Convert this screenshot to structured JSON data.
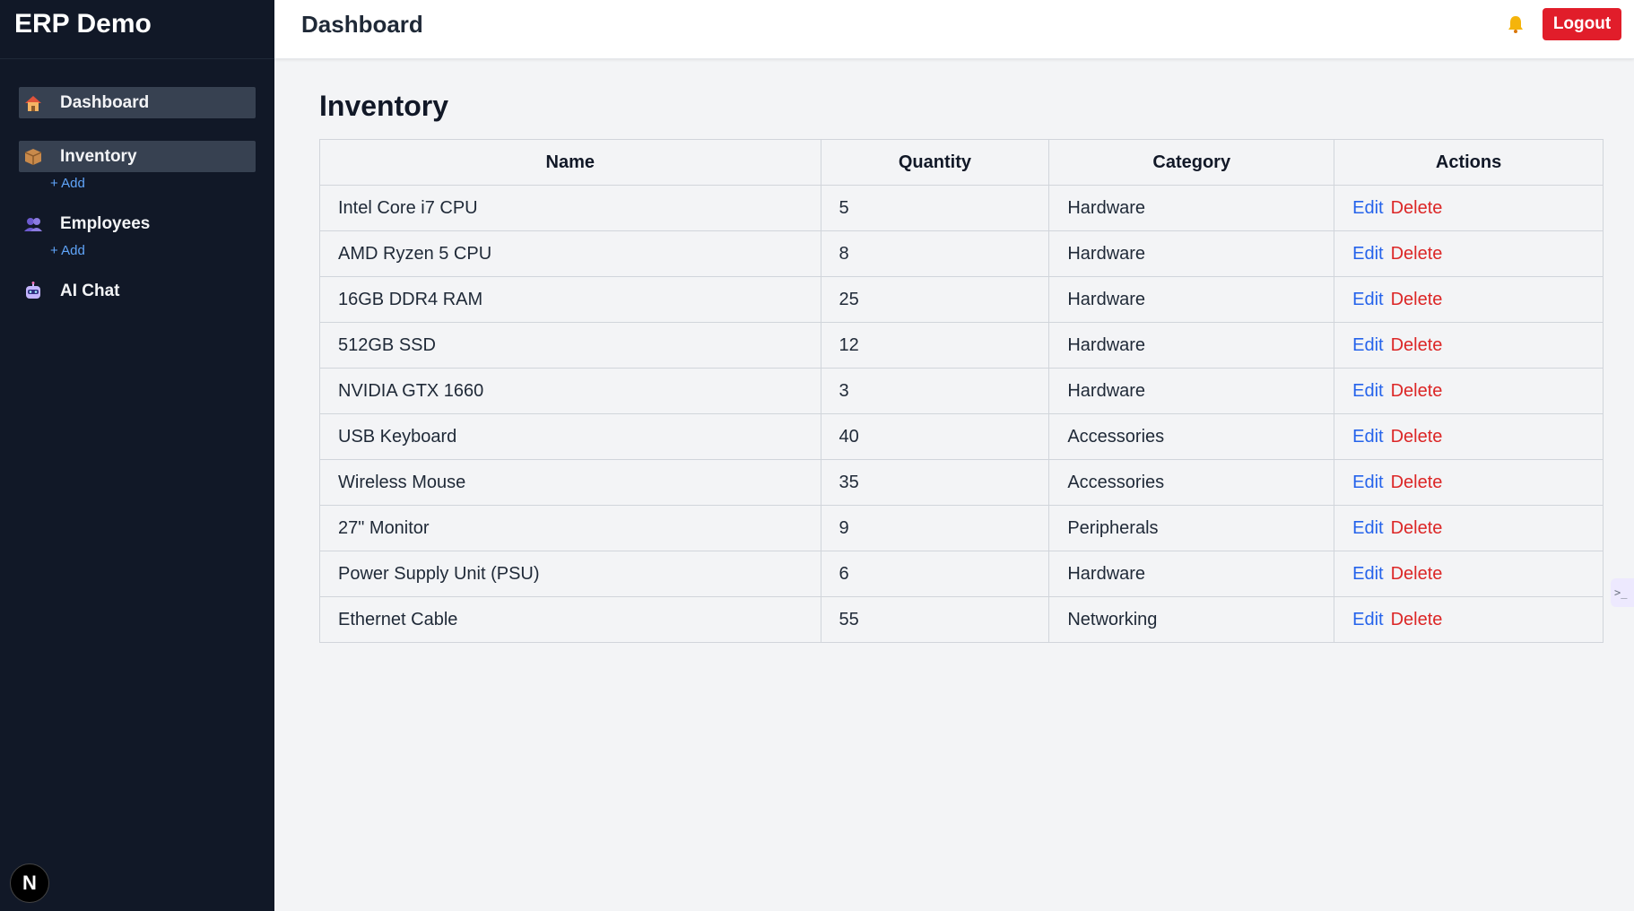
{
  "brand": "ERP Demo",
  "sidebar": {
    "items": [
      {
        "label": "Dashboard",
        "icon": "house-icon"
      },
      {
        "label": "Inventory",
        "icon": "package-icon",
        "sub": "+ Add"
      },
      {
        "label": "Employees",
        "icon": "people-icon",
        "sub": "+ Add"
      },
      {
        "label": "AI Chat",
        "icon": "robot-icon"
      }
    ]
  },
  "header": {
    "title": "Dashboard",
    "logout_label": "Logout"
  },
  "main": {
    "title": "Inventory",
    "columns": [
      "Name",
      "Quantity",
      "Category",
      "Actions"
    ],
    "edit_label": "Edit",
    "delete_label": "Delete",
    "rows": [
      {
        "name": "Intel Core i7 CPU",
        "qty": "5",
        "category": "Hardware"
      },
      {
        "name": "AMD Ryzen 5 CPU",
        "qty": "8",
        "category": "Hardware"
      },
      {
        "name": "16GB DDR4 RAM",
        "qty": "25",
        "category": "Hardware"
      },
      {
        "name": "512GB SSD",
        "qty": "12",
        "category": "Hardware"
      },
      {
        "name": "NVIDIA GTX 1660",
        "qty": "3",
        "category": "Hardware"
      },
      {
        "name": "USB Keyboard",
        "qty": "40",
        "category": "Accessories"
      },
      {
        "name": "Wireless Mouse",
        "qty": "35",
        "category": "Accessories"
      },
      {
        "name": "27\" Monitor",
        "qty": "9",
        "category": "Peripherals"
      },
      {
        "name": "Power Supply Unit (PSU)",
        "qty": "6",
        "category": "Hardware"
      },
      {
        "name": "Ethernet Cable",
        "qty": "55",
        "category": "Networking"
      }
    ]
  },
  "badge": "N",
  "colors": {
    "sidebar_bg": "#111827",
    "active_item": "#374151",
    "logout": "#e11d2a",
    "edit": "#2563eb",
    "delete": "#dc2626"
  }
}
